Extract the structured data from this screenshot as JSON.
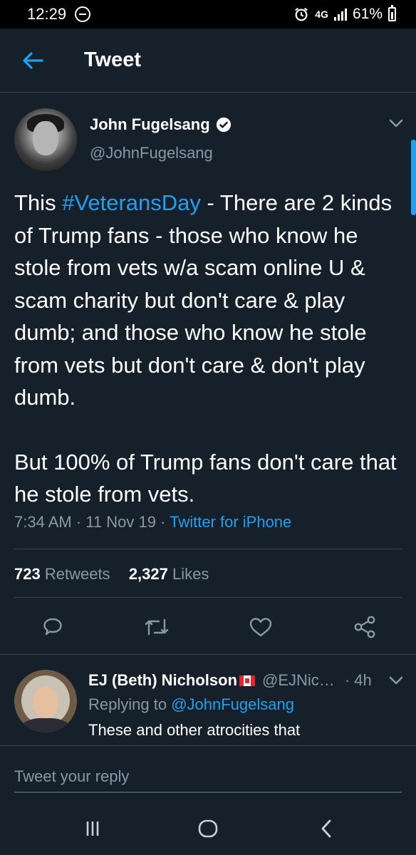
{
  "status_bar": {
    "time": "12:29",
    "network": "4G",
    "battery": "61%",
    "icons": [
      "do-not-disturb-icon",
      "alarm-icon",
      "signal-icon",
      "battery-icon"
    ]
  },
  "header": {
    "title": "Tweet",
    "back_icon": "arrow-left-icon"
  },
  "tweet": {
    "author_name": "John Fugelsang",
    "author_handle": "@JohnFugelsang",
    "verified": true,
    "text_prefix": "This ",
    "hashtag": "#VeteransDay",
    "text_rest": " - There are 2 kinds of Trump fans - those who know he stole from vets w/a scam online U & scam charity but don't care & play dumb; and those who know he stole from vets but don't care & don't play dumb.",
    "text_second": "But 100% of Trump fans don't care that he stole from vets.",
    "time": "7:34 AM",
    "date": "11 Nov 19",
    "source": "Twitter for iPhone",
    "separator": " · ",
    "retweets_count": "723",
    "retweets_label": "Retweets",
    "likes_count": "2,327",
    "likes_label": "Likes"
  },
  "reply": {
    "author_name": "EJ (Beth) Nicholson",
    "flag": "canada-flag-icon",
    "author_handle": "@EJNic…",
    "time": "· 4h",
    "replying_label": "Replying to ",
    "replying_to": "@JohnFugelsang",
    "text": "These and other atrocities that"
  },
  "composer": {
    "placeholder": "Tweet your reply"
  },
  "colors": {
    "background": "#15202b",
    "accent": "#1da1f2",
    "secondary_text": "#8899a6",
    "divider": "#38444d"
  }
}
